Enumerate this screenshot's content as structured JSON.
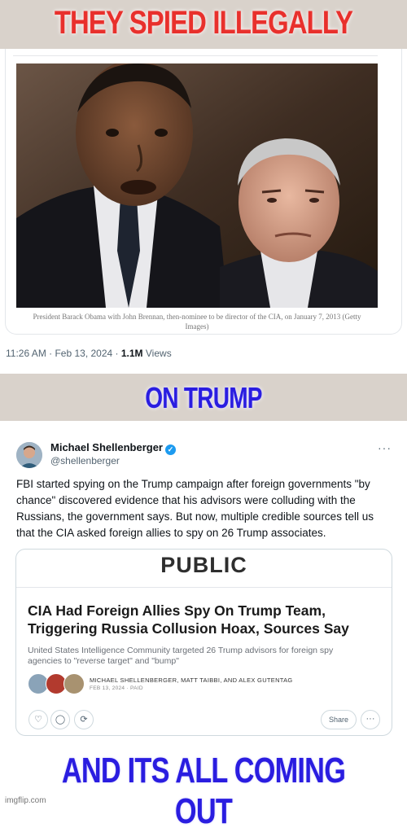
{
  "captions": {
    "top": "THEY SPIED ILLEGALLY",
    "middle": "ON TRUMP",
    "bottom": "AND ITS ALL COMING OUT"
  },
  "first_post": {
    "photo_caption": "President Barack Obama with John Brennan, then-nominee to be director of the CIA, on January 7, 2013 (Getty Images)",
    "time_date": "11:26 AM · Feb 13, 2024 · ",
    "views_count": "1.1M",
    "views_label": " Views"
  },
  "tweet": {
    "author_name": "Michael Shellenberger",
    "handle": "@shellenberger",
    "more_icon": "more-dots-icon",
    "text": "FBI started spying on the Trump campaign after foreign governments \"by chance\" discovered evidence that his advisors were colluding with the Russians, the government says. But now, multiple credible sources tell us that the CIA asked foreign allies to spy on 26 Trump associates.",
    "link_card": {
      "publication": "PUBLIC",
      "headline": "CIA Had Foreign Allies Spy On Trump Team, Triggering Russia Collusion Hoax, Sources Say",
      "dek": "United States Intelligence Community targeted 26 Trump advisors for foreign spy agencies to \"reverse target\" and \"bump\"",
      "authors": "MICHAEL SHELLENBERGER, MATT TAIBBI, AND ALEX GUTENTAG",
      "date": "FEB 13, 2024 · PAID"
    },
    "actions": {
      "share_label": "Share",
      "more_label": "···"
    }
  },
  "watermark": "imgflip.com",
  "colors": {
    "caption_red": "#e8302c",
    "caption_blue": "#2a1de0",
    "verified_blue": "#1d9bf0"
  }
}
